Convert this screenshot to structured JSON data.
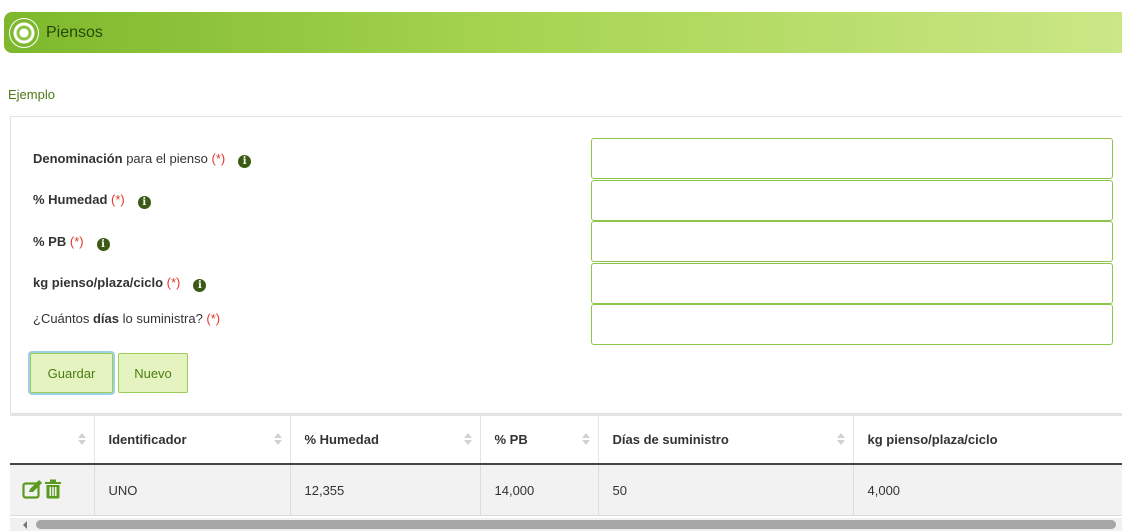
{
  "header": {
    "title": "Piensos",
    "logo_icon": "leaf-logo-icon"
  },
  "sub_link": "Ejemplo",
  "form": {
    "required_mark": "(*)",
    "fields": [
      {
        "bold": "Denominación",
        "rest": " para el pienso ",
        "prefix": "",
        "has_info": true,
        "value": ""
      },
      {
        "bold": "% Humedad",
        "rest": " ",
        "prefix": "",
        "has_info": true,
        "value": ""
      },
      {
        "bold": "% PB",
        "rest": " ",
        "prefix": "",
        "has_info": true,
        "value": ""
      },
      {
        "bold": "kg pienso/plaza/ciclo",
        "rest": " ",
        "prefix": "",
        "has_info": true,
        "value": ""
      },
      {
        "prefix": "¿Cuántos ",
        "bold": "días",
        "rest": " lo suministra? ",
        "has_info": false,
        "value": ""
      }
    ],
    "buttons": {
      "save": "Guardar",
      "new": "Nuevo"
    }
  },
  "table": {
    "columns": [
      "",
      "Identificador",
      "% Humedad",
      "% PB",
      "Días de suministro",
      "kg pienso/plaza/ciclo"
    ],
    "rows": [
      {
        "identificador": "UNO",
        "humedad": "12,355",
        "pb": "14,000",
        "dias": "50",
        "kg": "4,000"
      }
    ]
  },
  "colors": {
    "accent": "#8cc23f",
    "required": "#e0372b",
    "header_text": "#234a06"
  }
}
